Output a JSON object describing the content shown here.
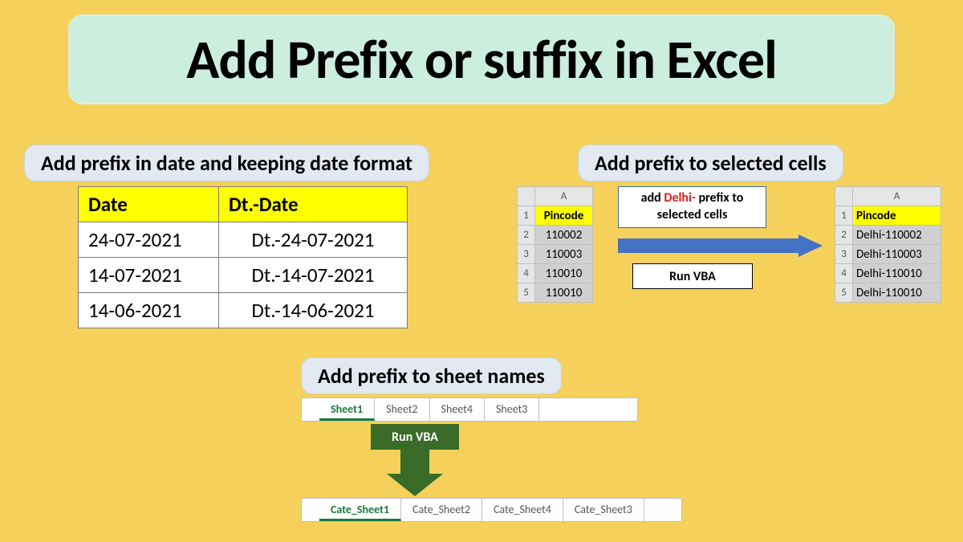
{
  "title": "Add Prefix or suffix in Excel",
  "section1": {
    "label": "Add prefix in date and keeping date format",
    "headers": {
      "a": "Date",
      "b": "Dt.-Date"
    },
    "rows": [
      {
        "a": "24-07-2021",
        "b": "Dt.-24-07-2021"
      },
      {
        "a": "14-07-2021",
        "b": "Dt.-14-07-2021"
      },
      {
        "a": "14-06-2021",
        "b": "Dt.-14-06-2021"
      }
    ]
  },
  "section2": {
    "label": "Add prefix to selected cells",
    "col_label": "A",
    "header": "Pincode",
    "left_values": [
      "110002",
      "110003",
      "110010",
      "110010"
    ],
    "right_values": [
      "Delhi-110002",
      "Delhi-110003",
      "Delhi-110010",
      "Delhi-110010"
    ],
    "callout_prefix": "add ",
    "callout_highlight": "Delhi-",
    "callout_suffix": " prefix to selected cells",
    "run_label": "Run VBA"
  },
  "section3": {
    "label": "Add prefix to sheet names",
    "run_label": "Run VBA",
    "tabs_before": [
      "Sheet1",
      "Sheet2",
      "Sheet4",
      "Sheet3"
    ],
    "tabs_after": [
      "Cate_Sheet1",
      "Cate_Sheet2",
      "Cate_Sheet4",
      "Cate_Sheet3"
    ]
  }
}
